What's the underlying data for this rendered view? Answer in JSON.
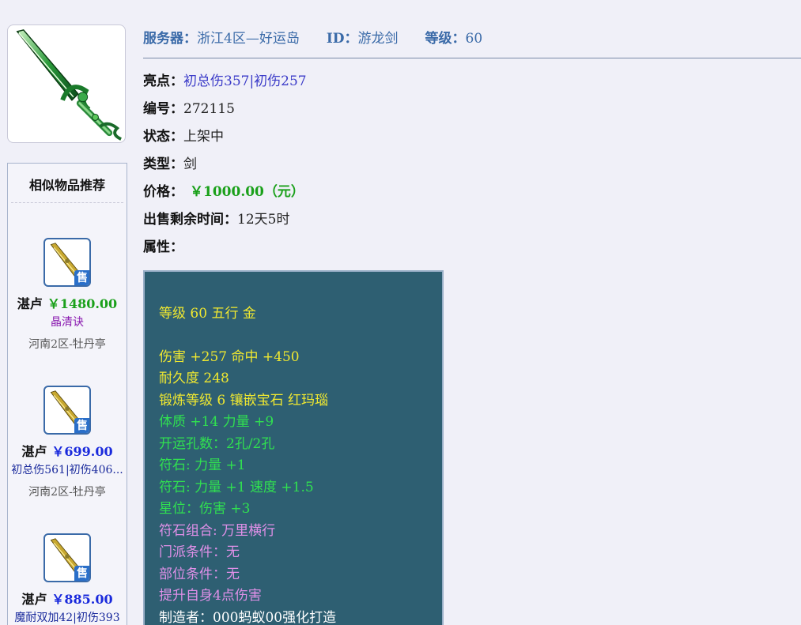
{
  "header": {
    "server_label": "服务器：",
    "server_value": "浙江4区—好运岛",
    "id_label": "ID：",
    "id_value": "游龙剑",
    "level_label": "等级：",
    "level_value": "60"
  },
  "details": {
    "highlight_label": "亮点：",
    "highlight_value": "初总伤357|初伤257",
    "number_label": "编号：",
    "number_value": "272115",
    "status_label": "状态：",
    "status_value": "上架中",
    "type_label": "类型：",
    "type_value": "剑",
    "price_label": "价格：",
    "price_value": "￥1000.00（元）",
    "remaining_label": "出售剩余时间：",
    "remaining_value": "12天5时",
    "attr_label": "属性："
  },
  "attributes": [
    {
      "text": "等级 60 五行 金",
      "color": "#f0e830"
    },
    {
      "text": "伤害 +257 命中 +450",
      "color": "#f0e830"
    },
    {
      "text": "耐久度 248",
      "color": "#f0e830"
    },
    {
      "text": "锻炼等级 6 镶嵌宝石 红玛瑙",
      "color": "#f0e830"
    },
    {
      "text": "体质 +14 力量 +9",
      "color": "#30e050"
    },
    {
      "text": "开运孔数：2孔/2孔",
      "color": "#30e050"
    },
    {
      "text": "符石: 力量 +1",
      "color": "#30e050"
    },
    {
      "text": "符石: 力量 +1 速度 +1.5",
      "color": "#30e050"
    },
    {
      "text": "星位：伤害 +3",
      "color": "#30e050"
    },
    {
      "text": "符石组合: 万里横行",
      "color": "#e090e8"
    },
    {
      "text": "门派条件：无",
      "color": "#e090e8"
    },
    {
      "text": "部位条件：无",
      "color": "#e090e8"
    },
    {
      "text": "提升自身4点伤害",
      "color": "#e090e8"
    },
    {
      "text": "制造者：000蚂蚁00强化打造",
      "color": "#ffffff"
    }
  ],
  "similar": {
    "title": "相似物品推荐",
    "badge": "售",
    "items": [
      {
        "seller": "湛卢",
        "price": "￥1480.00",
        "desc": "晶清诀",
        "server": "河南2区-牡丹亭"
      },
      {
        "seller": "湛卢",
        "price": "￥699.00",
        "desc": "初总伤561|初伤406...",
        "server": "河南2区-牡丹亭"
      },
      {
        "seller": "湛卢",
        "price": "￥885.00",
        "desc": "魔耐双加42|初伤393",
        "server": ""
      }
    ]
  }
}
